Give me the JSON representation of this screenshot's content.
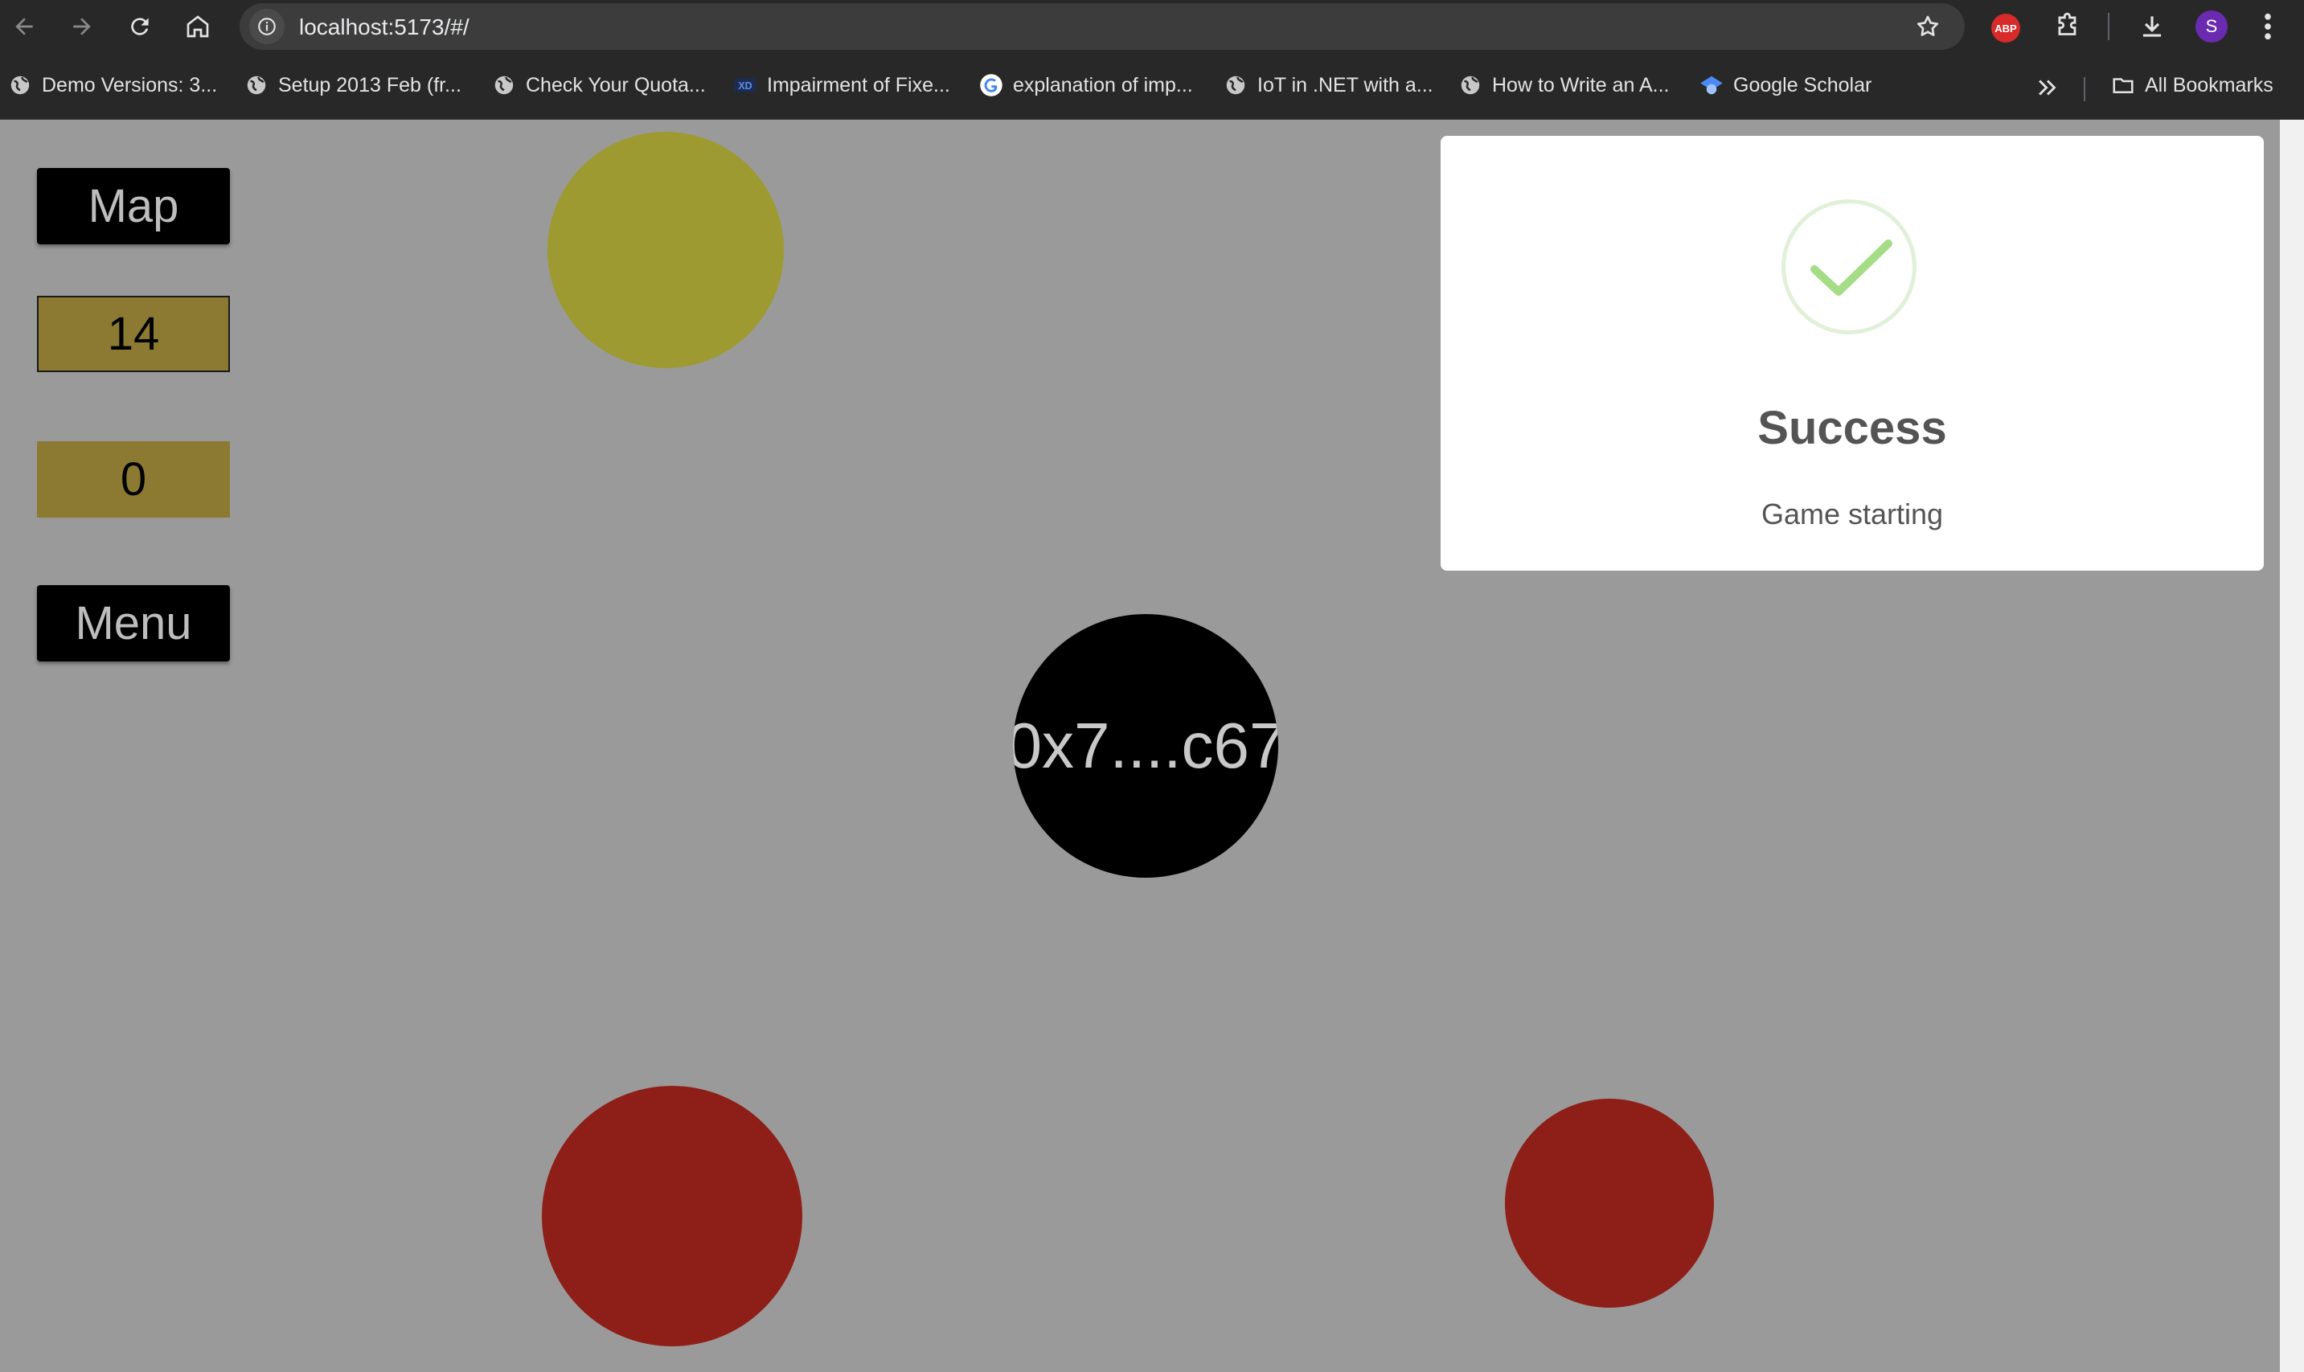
{
  "browser": {
    "url": "localhost:5173/#/",
    "avatar_initial": "S",
    "abp_label": "ABP",
    "bookmarks": [
      {
        "label": "Demo Versions: 3...",
        "icon": "globe-icon"
      },
      {
        "label": "Setup 2013 Feb (fr...",
        "icon": "globe-icon"
      },
      {
        "label": "Check Your Quota...",
        "icon": "globe-icon"
      },
      {
        "label": "Impairment of Fixe...",
        "icon": "xd-icon"
      },
      {
        "label": "explanation of imp...",
        "icon": "google-icon"
      },
      {
        "label": "IoT in .NET with a...",
        "icon": "globe-icon"
      },
      {
        "label": "How to Write an A...",
        "icon": "globe-icon"
      },
      {
        "label": "Google Scholar",
        "icon": "scholar-icon"
      }
    ],
    "all_bookmarks": "All Bookmarks"
  },
  "game": {
    "map_label": "Map",
    "score": "14",
    "secondary_count": "0",
    "menu_label": "Menu",
    "player_label": "0x7....c67",
    "colors": {
      "background": "#9a9a9a",
      "yellow_orb": "#9c9a30",
      "red_orb": "#8e1e18",
      "stat_box": "#8c7a33",
      "player": "#000000"
    }
  },
  "toast": {
    "title": "Success",
    "message": "Game starting",
    "icon": "check-icon",
    "accent": "#a5dc86"
  }
}
